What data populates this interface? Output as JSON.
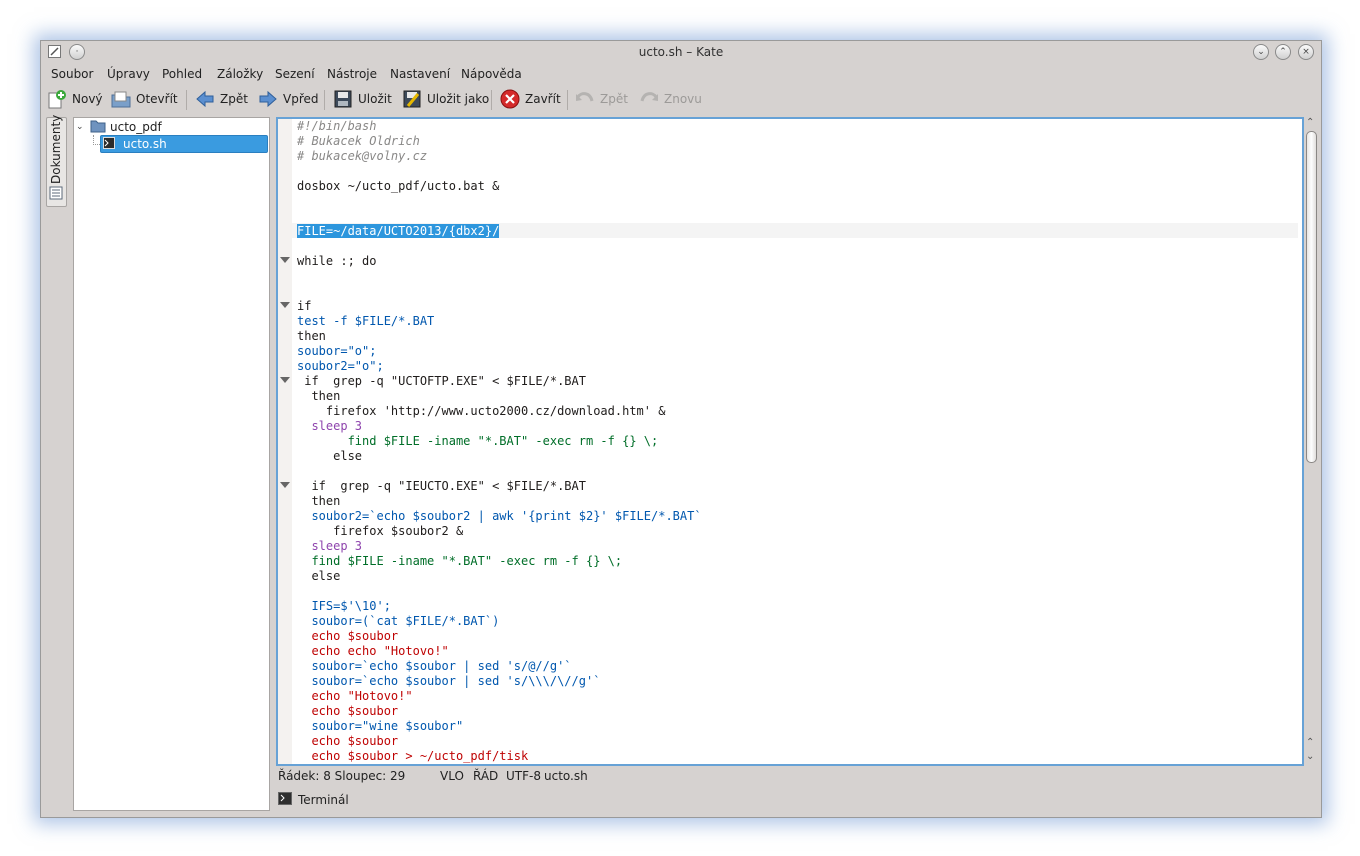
{
  "window": {
    "title": "ucto.sh – Kate"
  },
  "menu": [
    "Soubor",
    "Úpravy",
    "Pohled",
    "Záložky",
    "Sezení",
    "Nástroje",
    "Nastavení",
    "Nápověda"
  ],
  "toolbar": {
    "new": "Nový",
    "open": "Otevřít",
    "back": "Zpět",
    "forward": "Vpřed",
    "save": "Uložit",
    "save_as": "Uložit jako",
    "close": "Zavřít",
    "undo": "Zpět",
    "redo": "Znovu"
  },
  "sidebar": {
    "tab_label": "Dokumenty"
  },
  "tree": {
    "folder": "ucto_pdf",
    "file": "ucto.sh"
  },
  "editor": {
    "lines": [
      "#!/bin/bash",
      "# Bukacek Oldrich",
      "# bukacek@volny.cz",
      "",
      "dosbox ~/ucto_pdf/ucto.bat &",
      "",
      "",
      "FILE=~/data/UCTO2013/{dbx2}/",
      "",
      "while :; do",
      "",
      "",
      "if",
      "test -f $FILE/*.BAT",
      "then",
      "soubor=\"o\";",
      "soubor2=\"o\";",
      " if  grep -q \"UCTOFTP.EXE\" < $FILE/*.BAT",
      "  then",
      "    firefox 'http://www.ucto2000.cz/download.htm' &",
      "  sleep 3",
      "       find $FILE -iname \"*.BAT\" -exec rm -f {} \\;",
      "     else",
      "",
      "  if  grep -q \"IEUCTO.EXE\" < $FILE/*.BAT",
      "  then",
      "  soubor2=`echo $soubor2 | awk '{print $2}' $FILE/*.BAT`",
      "     firefox $soubor2 &",
      "  sleep 3",
      "  find $FILE -iname \"*.BAT\" -exec rm -f {} \\;",
      "  else",
      "",
      "  IFS=$'\\10';",
      "  soubor=(`cat $FILE/*.BAT`)",
      "  echo $soubor",
      "  echo echo \"Hotovo!\"",
      "  soubor=`echo $soubor | sed 's/@//g'`",
      "  soubor=`echo $soubor | sed 's/\\\\\\/\\//g'`",
      "  echo \"Hotovo!\"",
      "  echo $soubor",
      "  soubor=\"wine $soubor\"",
      "  echo $soubor",
      "  echo $soubor > ~/ucto_pdf/tisk"
    ]
  },
  "status": {
    "position": "Řádek: 8 Sloupec: 29",
    "mode1": "VLO",
    "mode2": "ŘÁD",
    "encoding": "UTF-8",
    "filename": "ucto.sh"
  },
  "bottom_panel": {
    "terminal": "Terminál"
  },
  "colors": {
    "selection": "#2d96dd",
    "focus_border": "#67a2d6",
    "window_bg": "#d6d2d0"
  }
}
